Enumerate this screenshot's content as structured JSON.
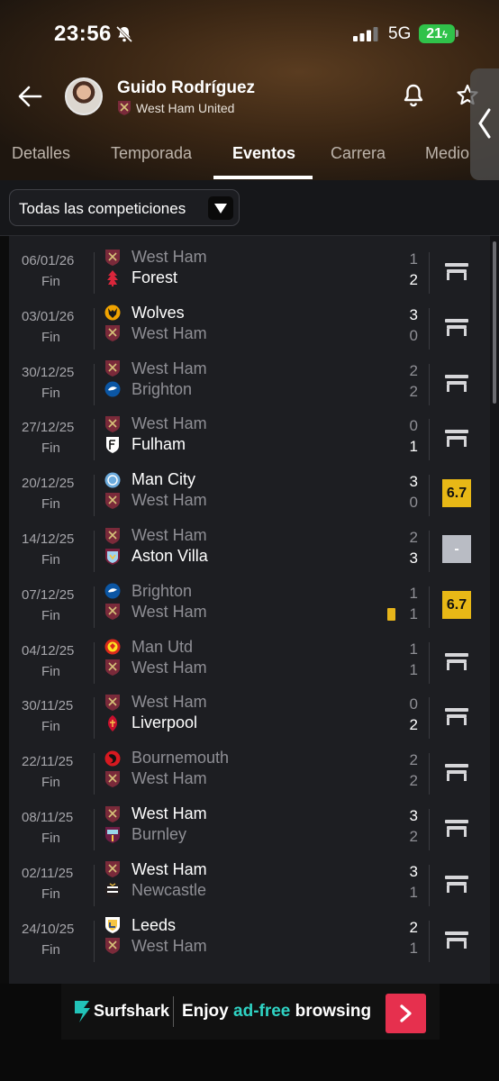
{
  "status_bar": {
    "time": "23:56",
    "network": "5G",
    "battery": "21"
  },
  "player": {
    "name": "Guido Rodríguez",
    "team": "West Ham United"
  },
  "tabs": [
    {
      "label": "Detalles",
      "active": false
    },
    {
      "label": "Temporada",
      "active": false
    },
    {
      "label": "Eventos",
      "active": true
    },
    {
      "label": "Carrera",
      "active": false
    },
    {
      "label": "Medio",
      "active": false
    }
  ],
  "filter": {
    "label": "Todas las competiciones"
  },
  "colors": {
    "accent_yellow": "#e8b816",
    "win_text": "#ffffff",
    "loss_text": "#8f8f95",
    "ad_accent": "#2fd3c4",
    "ad_button": "#e6304e"
  },
  "matches": [
    {
      "date": "06/01/26",
      "status": "Fin",
      "home": "West Ham",
      "away": "Forest",
      "home_crest": "west-ham-crest",
      "away_crest": "forest-crest",
      "home_score": "1",
      "away_score": "2",
      "winner": "away",
      "rating": null,
      "bench": true
    },
    {
      "date": "03/01/26",
      "status": "Fin",
      "home": "Wolves",
      "away": "West Ham",
      "home_crest": "wolves-crest",
      "away_crest": "west-ham-crest",
      "home_score": "3",
      "away_score": "0",
      "winner": "home",
      "rating": null,
      "bench": true
    },
    {
      "date": "30/12/25",
      "status": "Fin",
      "home": "West Ham",
      "away": "Brighton",
      "home_crest": "west-ham-crest",
      "away_crest": "brighton-crest",
      "home_score": "2",
      "away_score": "2",
      "winner": "none",
      "rating": null,
      "bench": true
    },
    {
      "date": "27/12/25",
      "status": "Fin",
      "home": "West Ham",
      "away": "Fulham",
      "home_crest": "west-ham-crest",
      "away_crest": "fulham-crest",
      "home_score": "0",
      "away_score": "1",
      "winner": "away",
      "rating": null,
      "bench": true
    },
    {
      "date": "20/12/25",
      "status": "Fin",
      "home": "Man City",
      "away": "West Ham",
      "home_crest": "man-city-crest",
      "away_crest": "west-ham-crest",
      "home_score": "3",
      "away_score": "0",
      "winner": "home",
      "rating": "6.7",
      "rating_color": "yellow",
      "bench": false
    },
    {
      "date": "14/12/25",
      "status": "Fin",
      "home": "West Ham",
      "away": "Aston Villa",
      "home_crest": "west-ham-crest",
      "away_crest": "aston-villa-crest",
      "home_score": "2",
      "away_score": "3",
      "winner": "away",
      "rating": "-",
      "rating_color": "grey",
      "bench": false
    },
    {
      "date": "07/12/25",
      "status": "Fin",
      "home": "Brighton",
      "away": "West Ham",
      "home_crest": "brighton-crest",
      "away_crest": "west-ham-crest",
      "home_score": "1",
      "away_score": "1",
      "winner": "none",
      "rating": "6.7",
      "rating_color": "yellow",
      "bench": false,
      "yellow_card": true
    },
    {
      "date": "04/12/25",
      "status": "Fin",
      "home": "Man Utd",
      "away": "West Ham",
      "home_crest": "man-utd-crest",
      "away_crest": "west-ham-crest",
      "home_score": "1",
      "away_score": "1",
      "winner": "none",
      "rating": null,
      "bench": true
    },
    {
      "date": "30/11/25",
      "status": "Fin",
      "home": "West Ham",
      "away": "Liverpool",
      "home_crest": "west-ham-crest",
      "away_crest": "liverpool-crest",
      "home_score": "0",
      "away_score": "2",
      "winner": "away",
      "rating": null,
      "bench": true
    },
    {
      "date": "22/11/25",
      "status": "Fin",
      "home": "Bournemouth",
      "away": "West Ham",
      "home_crest": "bournemouth-crest",
      "away_crest": "west-ham-crest",
      "home_score": "2",
      "away_score": "2",
      "winner": "none",
      "rating": null,
      "bench": true
    },
    {
      "date": "08/11/25",
      "status": "Fin",
      "home": "West Ham",
      "away": "Burnley",
      "home_crest": "west-ham-crest",
      "away_crest": "burnley-crest",
      "home_score": "3",
      "away_score": "2",
      "winner": "home",
      "rating": null,
      "bench": true
    },
    {
      "date": "02/11/25",
      "status": "Fin",
      "home": "West Ham",
      "away": "Newcastle",
      "home_crest": "west-ham-crest",
      "away_crest": "newcastle-crest",
      "home_score": "3",
      "away_score": "1",
      "winner": "home",
      "rating": null,
      "bench": true
    },
    {
      "date": "24/10/25",
      "status": "Fin",
      "home": "Leeds",
      "away": "West Ham",
      "home_crest": "leeds-crest",
      "away_crest": "west-ham-crest",
      "home_score": "2",
      "away_score": "1",
      "winner": "home",
      "rating": null,
      "bench": true
    }
  ],
  "ad": {
    "brand": "Surfshark",
    "copy_1": "Enjoy",
    "copy_accent": "ad-free",
    "copy_2": "browsing"
  }
}
